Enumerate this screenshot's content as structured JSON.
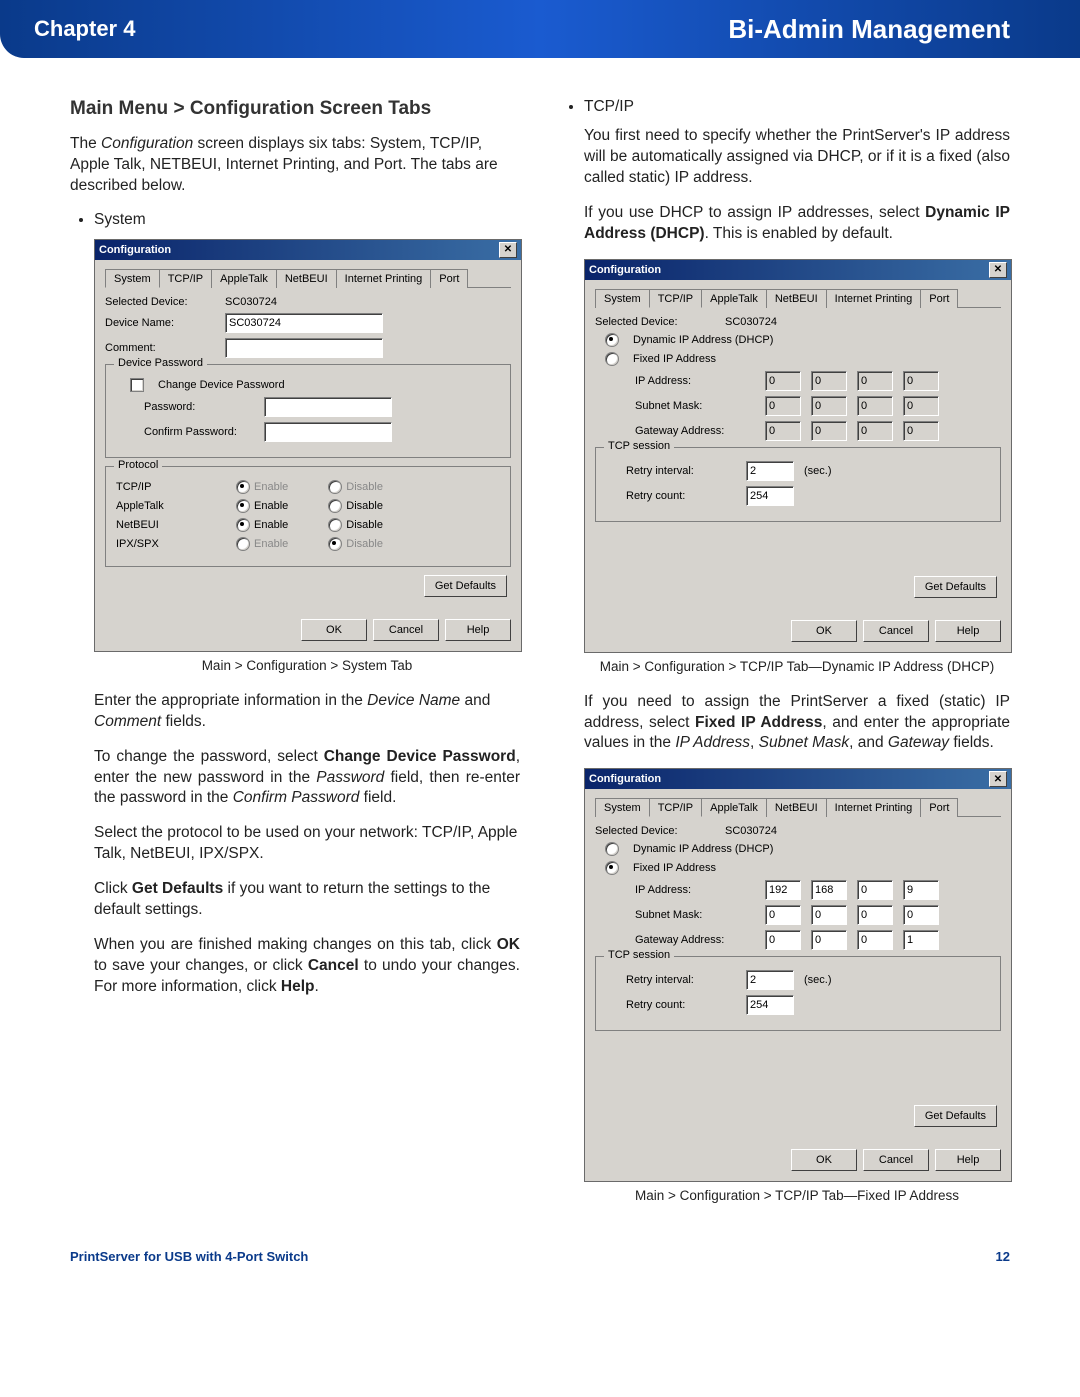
{
  "header": {
    "chapter": "Chapter 4",
    "title": "Bi-Admin Management"
  },
  "left": {
    "subhead": "Main Menu > Configuration Screen Tabs",
    "intro_html": "The <i>Configuration</i> screen displays six tabs: System, TCP/IP, Apple Talk, NETBEUI, Internet Printing, and Port. The tabs are described below.",
    "bullet_system": "System",
    "caption1": "Main > Configuration > System Tab",
    "para1_html": "Enter the appropriate information in the <i>Device Name</i> and <i>Comment</i> fields.",
    "para2_html": "To change the password, select <b>Change Device Password</b>, enter the new password in the <i>Password</i> field, then re-enter the password in the <i>Confirm Password</i> field.",
    "para3": "Select the protocol to be used on your network: TCP/IP, Apple Talk, NetBEUI, IPX/SPX.",
    "para4_html": "Click <b>Get Defaults</b> if you want to return the settings to the default settings.",
    "para5_html": "When you are finished making changes on this tab, click <b>OK</b> to save your changes, or click <b>Cancel</b> to undo your changes. For more information, click <b>Help</b>."
  },
  "right": {
    "bullet_tcpip": "TCP/IP",
    "para1": "You first need to specify whether the PrintServer's IP address will be automatically assigned via DHCP, or if it is a fixed (also called static) IP address.",
    "para2_html": "If you use DHCP to assign IP addresses, select <b>Dynamic IP Address (DHCP)</b>. This is enabled by default.",
    "caption2": "Main > Configuration > TCP/IP Tab—Dynamic IP Address (DHCP)",
    "para3_html": "If you need to assign the PrintServer a fixed (static) IP address, select <b>Fixed IP Address</b>, and enter the appropriate values in the <i>IP Address</i>, <i>Subnet Mask</i>, and <i>Gateway</i> fields.",
    "caption3": "Main > Configuration > TCP/IP Tab—Fixed IP Address"
  },
  "dialog": {
    "title": "Configuration",
    "tabs": [
      "System",
      "TCP/IP",
      "AppleTalk",
      "NetBEUI",
      "Internet Printing",
      "Port"
    ],
    "selected_device_label": "Selected Device:",
    "selected_device_value": "SC030724",
    "device_name_label": "Device Name:",
    "device_name_value": "SC030724",
    "comment_label": "Comment:",
    "device_password_legend": "Device Password",
    "change_pw_label": "Change Device Password",
    "password_label": "Password:",
    "confirm_password_label": "Confirm Password:",
    "protocol_legend": "Protocol",
    "proto_tcpip": "TCP/IP",
    "proto_appletalk": "AppleTalk",
    "proto_netbeui": "NetBEUI",
    "proto_ipxspx": "IPX/SPX",
    "enable": "Enable",
    "disable": "Disable",
    "get_defaults": "Get Defaults",
    "ok": "OK",
    "cancel": "Cancel",
    "help": "Help",
    "dynamic_ip_label": "Dynamic IP Address (DHCP)",
    "fixed_ip_label": "Fixed IP Address",
    "ip_address_label": "IP Address:",
    "subnet_mask_label": "Subnet Mask:",
    "gateway_label": "Gateway Address:",
    "tcp_session_legend": "TCP session",
    "retry_interval_label": "Retry interval:",
    "retry_interval_value": "2",
    "retry_interval_unit": "(sec.)",
    "retry_count_label": "Retry count:",
    "retry_count_value": "254",
    "ip_dhcp": {
      "ip": [
        "0",
        "0",
        "0",
        "0"
      ],
      "mask": [
        "0",
        "0",
        "0",
        "0"
      ],
      "gw": [
        "0",
        "0",
        "0",
        "0"
      ]
    },
    "ip_fixed": {
      "ip": [
        "192",
        "168",
        "0",
        "9"
      ],
      "mask": [
        "0",
        "0",
        "0",
        "0"
      ],
      "gw": [
        "0",
        "0",
        "0",
        "1"
      ]
    }
  },
  "footer": {
    "product": "PrintServer for USB with 4-Port Switch",
    "page": "12"
  }
}
